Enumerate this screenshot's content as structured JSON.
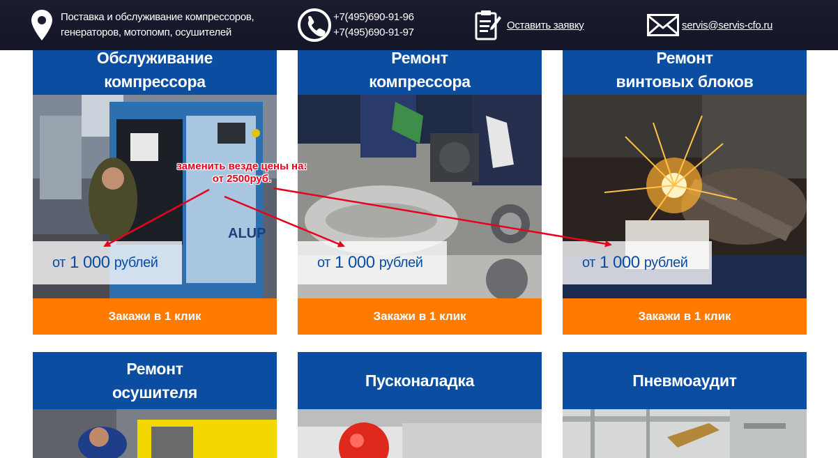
{
  "header": {
    "tagline_line1": "Поставка и обслуживание компрессоров,",
    "tagline_line2": "генераторов, мотопомп, осушителей",
    "phone1": "+7(495)690-91-96",
    "phone2": "+7(495)690-91-97",
    "request_label": "Оставить заявку",
    "email": "servis@servis-cfo.ru",
    "icons": [
      "location-pin-icon",
      "phone-icon",
      "clipboard-icon",
      "envelope-icon"
    ]
  },
  "colors": {
    "header_bg": "#1b1c2f",
    "card_head": "#0a4da1",
    "button": "#ff7a00",
    "annotation": "#e8001c"
  },
  "cards": [
    {
      "title": "Обслуживание\nкомпрессора",
      "price_prefix": "от",
      "price_value": "1 000",
      "price_unit": "рублей",
      "button": "Закажи в 1 клик"
    },
    {
      "title": "Ремонт\nкомпрессора",
      "price_prefix": "от",
      "price_value": "1 000",
      "price_unit": "рублей",
      "button": "Закажи в 1 клик"
    },
    {
      "title": "Ремонт\nвинтовых блоков",
      "price_prefix": "от",
      "price_value": "1 000",
      "price_unit": "рублей",
      "button": "Закажи в 1 клик"
    },
    {
      "title": "Ремонт\nосушителя"
    },
    {
      "title": "Пусконаладка"
    },
    {
      "title": "Пневмоаудит"
    }
  ],
  "annotation": {
    "line1": "заменить везде цены на:",
    "line2": "от 2500руб."
  }
}
